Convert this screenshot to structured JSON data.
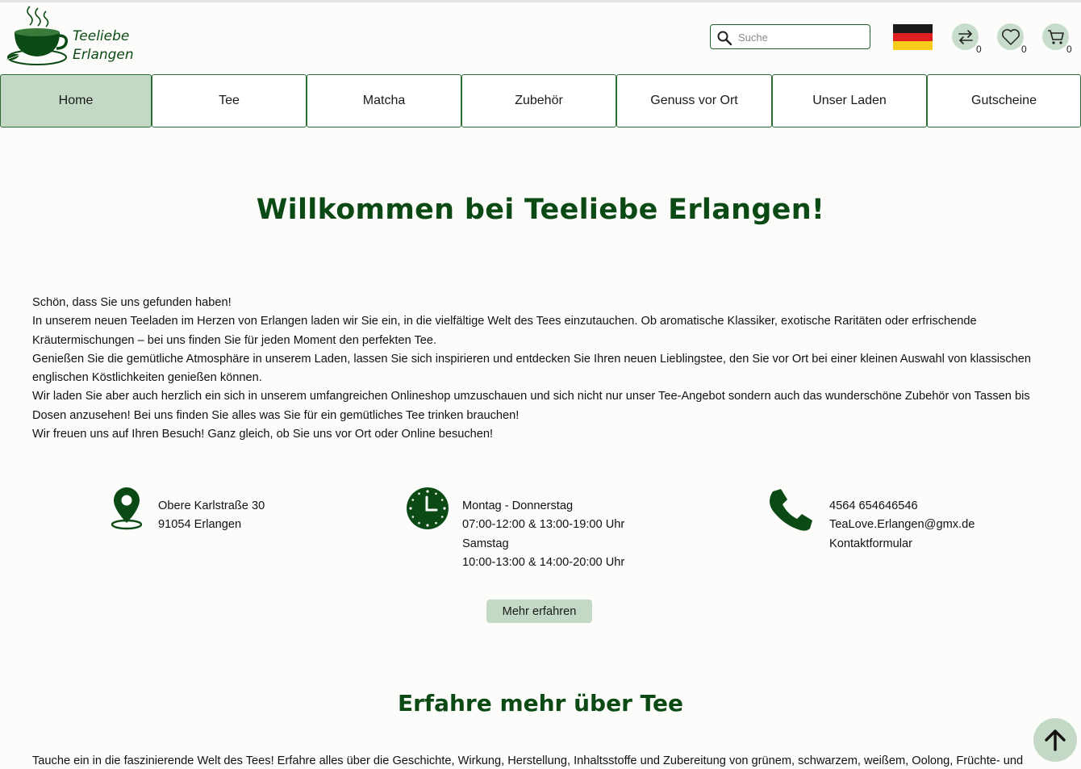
{
  "brand": {
    "line1": "Teeliebe",
    "line2": "Erlangen"
  },
  "header": {
    "search_placeholder": "Suche",
    "language_flag": "germany-flag",
    "compare_count": "0",
    "wishlist_count": "0",
    "cart_count": "0"
  },
  "nav": {
    "items": [
      {
        "label": "Home",
        "active": true
      },
      {
        "label": "Tee"
      },
      {
        "label": "Matcha"
      },
      {
        "label": "Zubehör"
      },
      {
        "label": "Genuss vor Ort"
      },
      {
        "label": "Unser Laden"
      },
      {
        "label": "Gutscheine"
      }
    ]
  },
  "main": {
    "title": "Willkommen bei Teeliebe Erlangen!",
    "intro": [
      "Schön, dass Sie uns gefunden haben!",
      "In unserem neuen Teeladen im Herzen von Erlangen laden wir Sie ein, in die vielfältige Welt des Tees einzutauchen. Ob aromatische Klassiker, exotische Raritäten oder erfrischende Kräutermischungen – bei uns finden Sie für jeden Moment den perfekten Tee.",
      "Genießen Sie die gemütliche Atmosphäre in unserem Laden, lassen Sie sich inspirieren und entdecken Sie Ihren neuen Lieblingstee, den Sie vor Ort bei einer kleinen Auswahl von klassischen englischen Köstlichkeiten genießen können.",
      "Wir laden Sie aber auch herzlich ein sich in unserem umfangreichen Onlineshop umzuschauen und sich nicht nur unser Tee-Angebot sondern auch das wunderschöne Zubehör von Tassen bis Dosen anzusehen! Bei uns finden Sie alles was Sie für ein gemütliches Tee trinken brauchen!",
      "Wir freuen uns auf Ihren Besuch! Ganz gleich, ob Sie uns vor Ort oder Online besuchen!"
    ],
    "address": {
      "street": "Obere Karlstraße 30",
      "city": "91054 Erlangen"
    },
    "hours": {
      "days1": "Montag - Donnerstag",
      "times1": "07:00-12:00 & 13:00-19:00 Uhr",
      "days2": "Samstag",
      "times2": "10:00-13:00 & 14:00-20:00 Uhr"
    },
    "contact": {
      "phone": "4564 654646546",
      "email": "TeaLove.Erlangen@gmx.de",
      "form": "Kontaktformular"
    },
    "more_button": "Mehr erfahren",
    "section_title": "Erfahre mehr über Tee",
    "section_teaser": "Tauche ein in die faszinierende Welt des Tees! Erfahre alles über die Geschichte, Wirkung, Herstellung, Inhaltsstoffe und Zubereitung von grünem, schwarzem, weißem, Oolong, Früchte- und"
  },
  "colors": {
    "brand_green": "#0b4a15",
    "accent_light": "#c3d9c6",
    "border_green": "#2c6b36",
    "background": "#fcfcfa"
  }
}
